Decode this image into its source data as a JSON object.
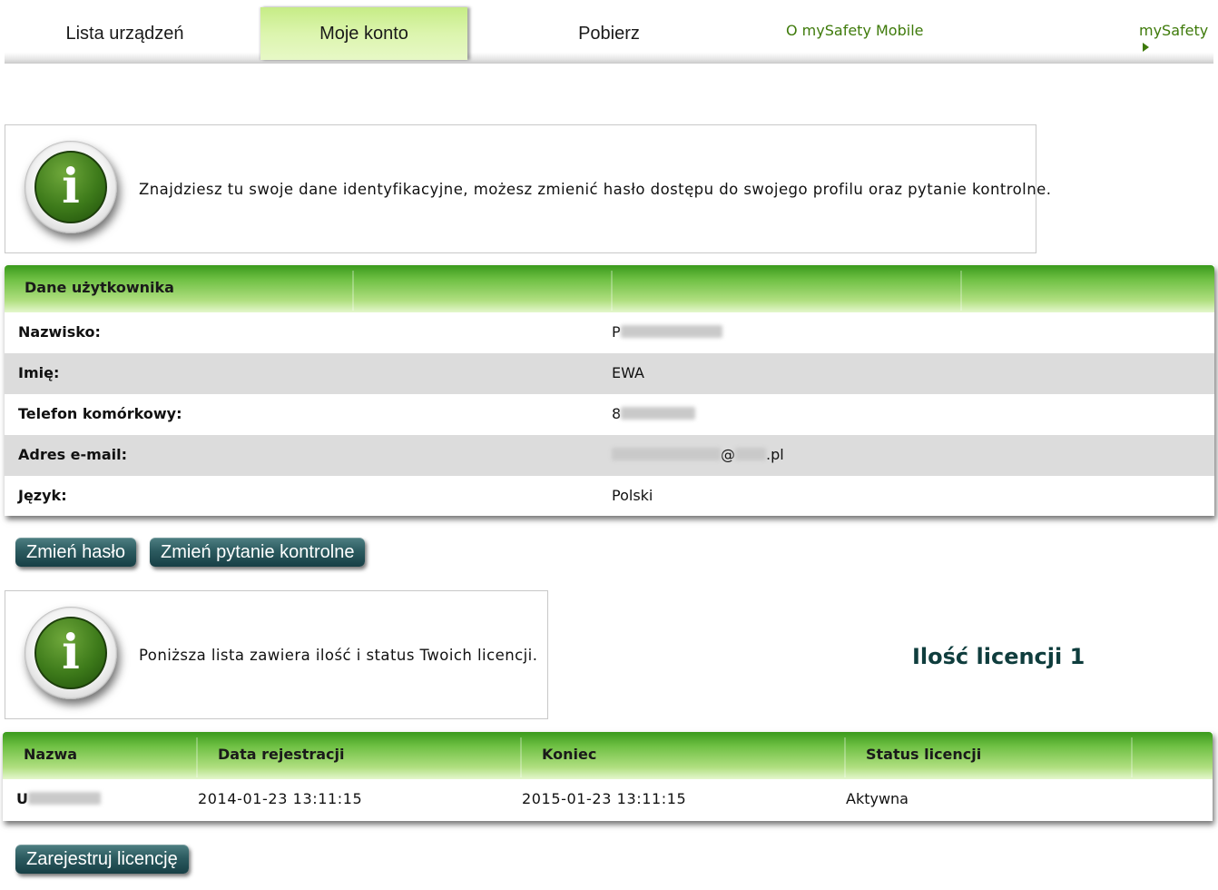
{
  "nav": {
    "tabs": [
      {
        "label": "Lista urządzeń",
        "active": false
      },
      {
        "label": "Moje konto",
        "active": true
      },
      {
        "label": "Pobierz",
        "active": false
      }
    ],
    "links": [
      {
        "label": "O mySafety Mobile"
      },
      {
        "label": "mySafety"
      }
    ],
    "accent_color": "#3e7a0a",
    "active_tab_color": "#dcf5ae"
  },
  "account_info": {
    "icon": "info-icon",
    "text": "Znajdziesz tu swoje dane identyfikacyjne, możesz zmienić hasło dostępu do swojego profilu oraz pytanie kontrolne."
  },
  "user_table": {
    "header": "Dane użytkownika",
    "rows": [
      {
        "label": "Nazwisko:",
        "value": "P"
      },
      {
        "label": "Imię:",
        "value": "EWA"
      },
      {
        "label": "Telefon komórkowy:",
        "value": "8"
      },
      {
        "label": "Adres e-mail:",
        "value_mid": "@",
        "value_end": ".pl"
      },
      {
        "label": "Język:",
        "value": "Polski"
      }
    ]
  },
  "buttons": {
    "change_password": "Zmień hasło",
    "change_question": "Zmień pytanie kontrolne",
    "register_license": "Zarejestruj licencję",
    "color": "#2c5b60"
  },
  "license_info": {
    "icon": "info-icon",
    "text": "Poniższa lista zawiera ilość i status Twoich licencji.",
    "count_label": "Ilość licencji 1"
  },
  "license_table": {
    "columns": [
      "Nazwa",
      "Data rejestracji",
      "Koniec",
      "Status licencji"
    ],
    "rows": [
      {
        "name": "U",
        "registered": "2014-01-23 13:11:15",
        "end": "2015-01-23 13:11:15",
        "status": "Aktywna"
      }
    ]
  },
  "header_gradient_color": "#6fc044"
}
